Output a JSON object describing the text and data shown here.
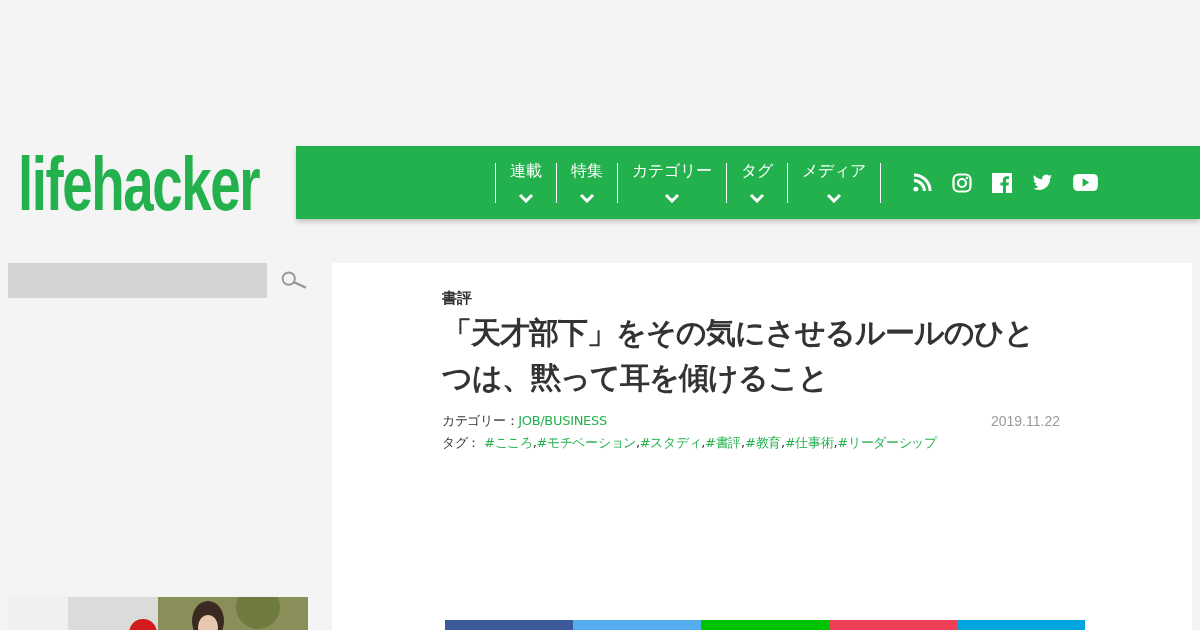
{
  "logo": {
    "text": "lifehacker"
  },
  "nav": {
    "items": [
      {
        "label": "連載"
      },
      {
        "label": "特集"
      },
      {
        "label": "カテゴリー"
      },
      {
        "label": "タグ"
      },
      {
        "label": "メディア"
      }
    ],
    "social": [
      {
        "kind": "rss"
      },
      {
        "kind": "instagram"
      },
      {
        "kind": "facebook"
      },
      {
        "kind": "twitter"
      },
      {
        "kind": "youtube"
      }
    ]
  },
  "article": {
    "section": "書評",
    "title": "「天才部下」をその気にさせるルールのひとつは、黙って耳を傾けること",
    "category_label": "カテゴリー：",
    "category": "JOB/BUSINESS",
    "date": "2019.11.22",
    "tags_label": "タグ：",
    "tag_separator": ",",
    "tags": [
      "#こころ",
      "#モチベーション",
      "#スタディ",
      "#書評",
      "#教育",
      "#仕事術",
      "#リーダーシップ"
    ],
    "share_buttons": [
      {
        "color": "#3b5998"
      },
      {
        "color": "#55acee"
      },
      {
        "color": "#00c300"
      },
      {
        "color": "#ef3f56"
      },
      {
        "color": "#00a4de"
      }
    ]
  }
}
